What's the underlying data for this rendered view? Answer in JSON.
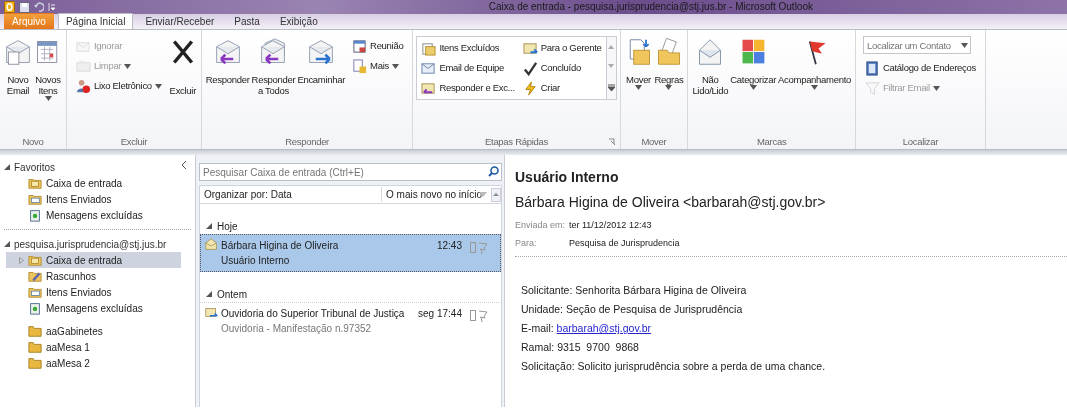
{
  "window": {
    "title": "Caixa de entrada - pesquisa.jurisprudencia@stj.jus.br - Microsoft Outlook"
  },
  "ribbon_tabs": [
    {
      "label": "Arquivo",
      "kind": "file",
      "selected": false
    },
    {
      "label": "Página Inicial",
      "kind": "tab",
      "selected": true
    },
    {
      "label": "Enviar/Receber",
      "kind": "tab",
      "selected": false
    },
    {
      "label": "Pasta",
      "kind": "tab",
      "selected": false
    },
    {
      "label": "Exibição",
      "kind": "tab",
      "selected": false
    }
  ],
  "ribbon_groups": [
    {
      "label": "Novo",
      "controls": [
        {
          "kind": "large",
          "label": "Novo\nEmail"
        },
        {
          "kind": "large",
          "label": "Novos\nItens",
          "dropdown": true
        }
      ]
    },
    {
      "label": "Excluir",
      "controls": [
        {
          "kind": "stack",
          "items": [
            {
              "label": "Ignorar",
              "disabled": true
            },
            {
              "label": "Limpar",
              "dropdown": true,
              "disabled": true
            },
            {
              "label": "Lixo Eletrônico",
              "dropdown": true,
              "disabled": false
            }
          ]
        },
        {
          "kind": "large",
          "label": "\nExcluir"
        }
      ]
    },
    {
      "label": "Responder",
      "controls": [
        {
          "kind": "large",
          "label": "Responder\n "
        },
        {
          "kind": "large",
          "label": "Responder\na Todos"
        },
        {
          "kind": "large",
          "label": "Encaminhar\n "
        },
        {
          "kind": "stack",
          "items": [
            {
              "label": "Reunião",
              "disabled": false
            },
            {
              "label": "Mais",
              "dropdown": true,
              "disabled": false
            }
          ]
        }
      ]
    },
    {
      "label": "Etapas Rápidas",
      "launcher": true,
      "controls": [
        {
          "kind": "gallery",
          "items": [
            {
              "label": "Itens Excluídos"
            },
            {
              "label": "Para o Gerente"
            },
            {
              "label": "Email de Equipe"
            },
            {
              "label": "Concluído"
            },
            {
              "label": "Responder e Exc..."
            },
            {
              "label": "Criar"
            }
          ]
        }
      ]
    },
    {
      "label": "Mover",
      "controls": [
        {
          "kind": "large",
          "label": "Mover",
          "dropdown": true
        },
        {
          "kind": "large",
          "label": "Regras",
          "dropdown": true
        }
      ]
    },
    {
      "label": "Marcas",
      "controls": [
        {
          "kind": "large",
          "label": "Não\nLido/Lido"
        },
        {
          "kind": "large",
          "label": "Categorizar",
          "dropdown": true
        },
        {
          "kind": "large",
          "label": "Acompanhamento",
          "dropdown": true
        }
      ]
    },
    {
      "label": "Localizar",
      "controls": [
        {
          "kind": "stack",
          "items": [
            {
              "kind": "combo",
              "placeholder": "Localizar um Contato",
              "disabled": false
            },
            {
              "label": "Catálogo de Endereços",
              "disabled": false
            },
            {
              "label": "Filtrar Email",
              "dropdown": true,
              "disabled": true
            }
          ]
        }
      ]
    }
  ],
  "folder_pane": {
    "sections": [
      {
        "label": "Favoritos",
        "expanded": true,
        "folders": [
          {
            "name": "Caixa de entrada",
            "kind": "inbox",
            "selected": false
          },
          {
            "name": "Itens Enviados",
            "kind": "sent",
            "selected": false
          },
          {
            "name": "Mensagens excluídas",
            "kind": "trash",
            "selected": false
          }
        ]
      },
      {
        "label": "pesquisa.jurisprudencia@stj.jus.br",
        "expanded": true,
        "folders": [
          {
            "name": "Caixa de entrada",
            "kind": "inbox",
            "selected": true,
            "has_subfolders": true
          },
          {
            "name": "Rascunhos",
            "kind": "drafts",
            "selected": false
          },
          {
            "name": "Itens Enviados",
            "kind": "sent",
            "selected": false
          },
          {
            "name": "Mensagens excluídas",
            "kind": "trash",
            "selected": false
          },
          {
            "name": "aaGabinetes",
            "kind": "folder",
            "selected": false,
            "gap": true
          },
          {
            "name": "aaMesa 1",
            "kind": "folder",
            "selected": false
          },
          {
            "name": "aaMesa 2",
            "kind": "folder",
            "selected": false
          }
        ]
      }
    ]
  },
  "message_list": {
    "search": {
      "placeholder": "Pesquisar Caixa de entrada (Ctrl+E)"
    },
    "arrange_by": "Organizar por: Data",
    "sort_order": "O mais novo no início",
    "groups": [
      {
        "label": "Hoje",
        "expanded": true,
        "messages": [
          {
            "sender": "Bárbara Higina de Oliveira",
            "subject": "Usuário Interno",
            "time": "12:43",
            "kind": "read",
            "selected": true
          }
        ]
      },
      {
        "label": "Ontem",
        "expanded": true,
        "messages": [
          {
            "sender": "Ouvidoria do Superior Tribunal de Justiça",
            "subject": "Ouvidoria - Manifestação n.97352",
            "time": "seg 17:44",
            "kind": "forwarded",
            "selected": false
          }
        ]
      }
    ]
  },
  "reading_pane": {
    "subject": "Usuário Interno",
    "from": "Bárbara Higina de Oliveira <barbarah@stj.gov.br>",
    "meta": [
      {
        "label": "Enviada em:",
        "value": "ter 11/12/2012 12:43"
      },
      {
        "label": "Para:",
        "value": "Pesquisa de Jurisprudencia"
      }
    ],
    "body": [
      {
        "text": "Solicitante: Senhorita Bárbara Higina de Oliveira"
      },
      {
        "text": "Unidade: Seção de Pesquisa de Jurisprudência"
      },
      {
        "text": "E-mail: ",
        "link": "barbarah@stj.gov.br"
      },
      {
        "text": "Ramal: 9315  9700  9868"
      },
      {
        "text": "Solicitação: Solicito jurisprudência sobre a perda de uma chance."
      }
    ]
  }
}
